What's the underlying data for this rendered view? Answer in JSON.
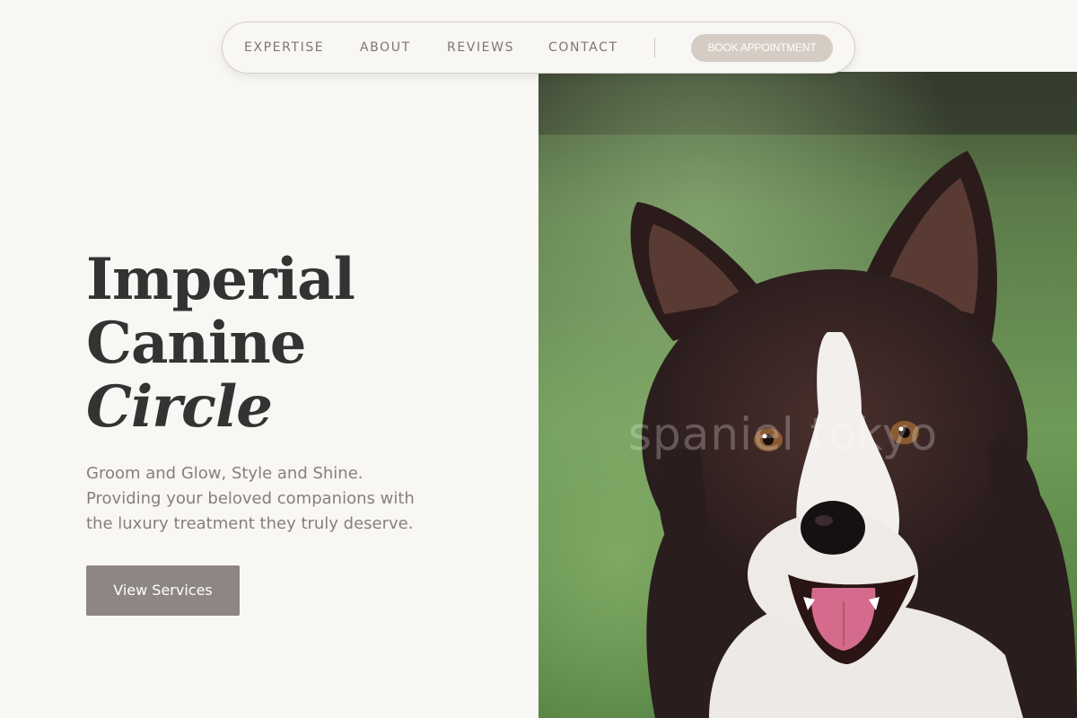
{
  "nav": {
    "links": [
      "EXPERTISE",
      "ABOUT",
      "REVIEWS",
      "CONTACT"
    ],
    "cta_label": "BOOK APPOINTMENT"
  },
  "hero": {
    "title_line1": "Imperial",
    "title_line2": "Canine",
    "title_line3": "Circle",
    "subtitle_line1": "Groom and Glow, Style and Shine.",
    "subtitle_line2": "Providing your beloved companions with",
    "subtitle_line3": "the luxury treatment they truly deserve.",
    "cta_label": "View Services"
  },
  "photo": {
    "watermark": "spaniel tokyo"
  },
  "colors": {
    "background": "#f9f7f4",
    "nav_cta": "#d5ccc4",
    "cta_button": "#8d8682",
    "title_text": "#333333",
    "subtitle_text": "#858079"
  }
}
